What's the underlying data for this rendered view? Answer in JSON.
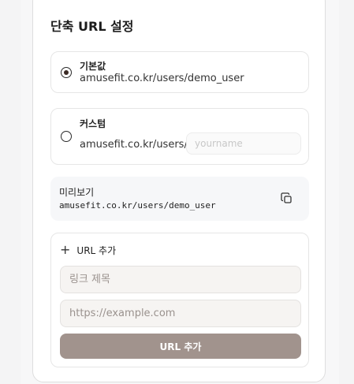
{
  "section": {
    "title": "단축 URL 설정"
  },
  "options": {
    "default": {
      "label": "기본값",
      "value": "amusefit.co.kr/users/demo_user",
      "selected": true
    },
    "custom": {
      "label": "커스텀",
      "prefix": "amusefit.co.kr/users/",
      "placeholder": "yourname",
      "value": "",
      "selected": false
    }
  },
  "preview": {
    "label": "미리보기",
    "value": "amusefit.co.kr/users/demo_user",
    "copy_icon": "copy-icon"
  },
  "add_url": {
    "header_label": "URL 추가",
    "header_icon": "plus-icon",
    "title_placeholder": "링크 제목",
    "url_placeholder": "https://example.com",
    "submit_label": "URL 추가"
  },
  "colors": {
    "submit_button": "#a1938d",
    "radio_selected": "#3b2a24",
    "preview_background": "#f6f7f9"
  }
}
